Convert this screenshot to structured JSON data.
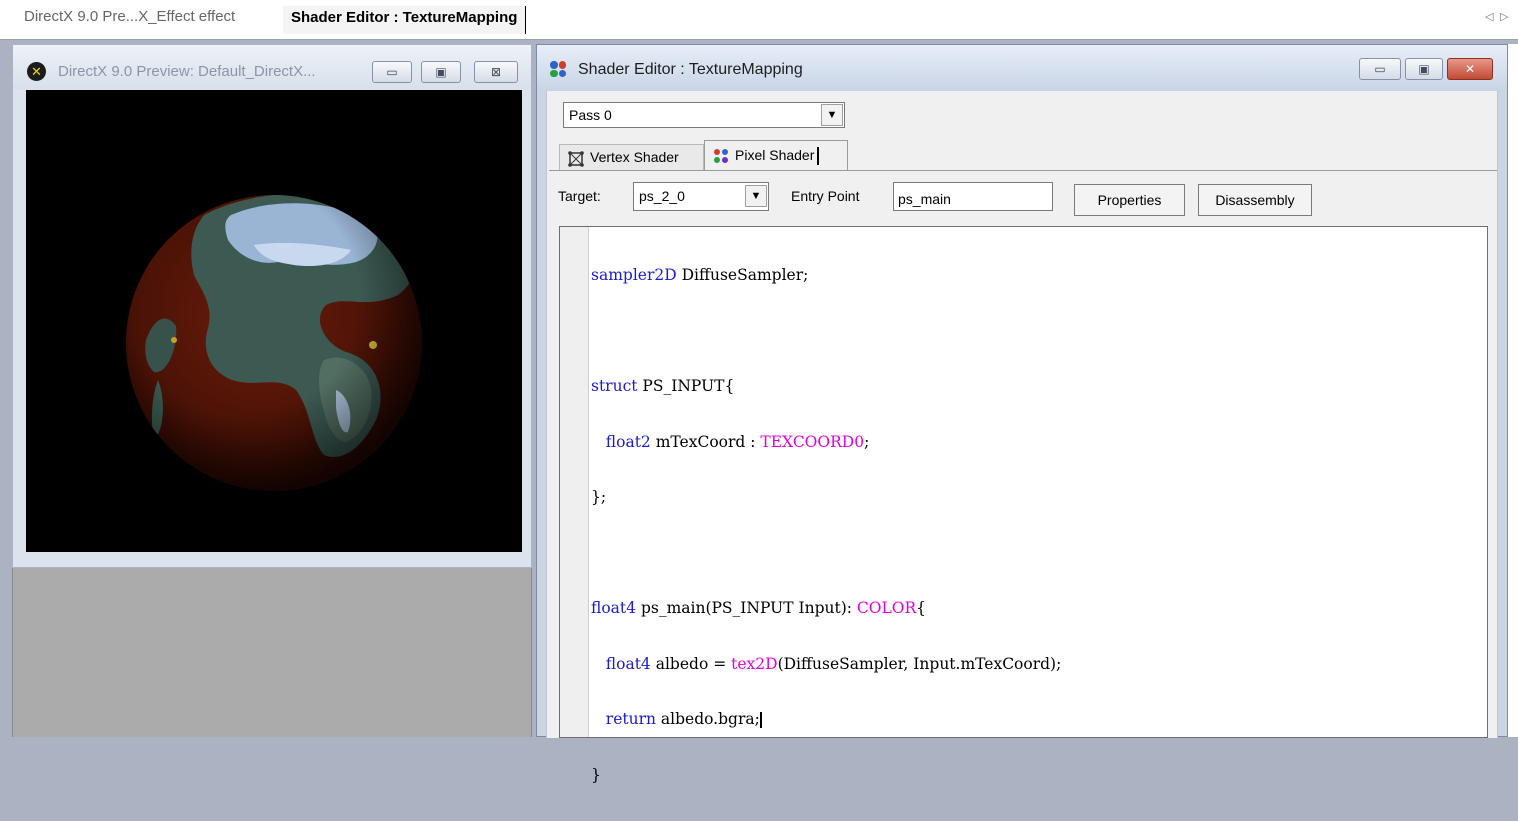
{
  "tab_bar": {
    "tabs": [
      {
        "label": "DirectX 9.0 Pre...X_Effect effect",
        "active": false
      },
      {
        "label": "Shader Editor : TextureMapping",
        "active": true
      }
    ],
    "scroll_left_icon": "triangle-left-icon",
    "scroll_right_icon": "triangle-right-icon"
  },
  "preview_window": {
    "title": "DirectX 9.0 Preview: Default_DirectX...",
    "icon": "directx-icon",
    "buttons": {
      "minimize": "▭",
      "maximize": "▣",
      "close": "⊠"
    }
  },
  "shader_editor": {
    "title": "Shader Editor : TextureMapping",
    "icon": "shader-editor-icon",
    "buttons": {
      "minimize": "▭",
      "maximize": "▣",
      "close": "✕"
    },
    "pass_select": {
      "value": "Pass 0"
    },
    "tabs": [
      {
        "label": "Vertex Shader",
        "icon": "vertex-shader-icon",
        "active": false
      },
      {
        "label": "Pixel Shader",
        "icon": "pixel-shader-icon",
        "active": true
      }
    ],
    "target_label": "Target:",
    "target_value": "ps_2_0",
    "entry_point_label": "Entry Point",
    "entry_point_value": "ps_main",
    "properties_button": "Properties",
    "disassembly_button": "Disassembly",
    "code": {
      "l1": {
        "kw1": "sampler2D",
        "rest": " DiffuseSampler;"
      },
      "l3": {
        "kw1": "struct",
        "rest": " PS_INPUT{"
      },
      "l4": {
        "indent": "   ",
        "kw1": "float2",
        "mid": " mTexCoord : ",
        "sem": "TEXCOORD0",
        "end": ";"
      },
      "l5": {
        "text": "};"
      },
      "l7": {
        "kw1": "float4",
        "mid": " ps_main(PS_INPUT Input): ",
        "sem": "COLOR",
        "end": "{"
      },
      "l8": {
        "indent": "   ",
        "kw1": "float4",
        "mid": " albedo = ",
        "sem": "tex2D",
        "end": "(DiffuseSampler, Input.mTexCoord);"
      },
      "l9": {
        "indent": "   ",
        "kw1": "return",
        "end": " albedo.bgra;"
      },
      "l10": {
        "text": "}"
      }
    }
  },
  "colors": {
    "keyword": "#1a1ad8",
    "semantic": "#e200e2",
    "viewport_background": "#000000",
    "mdi_background": "#ababab"
  }
}
